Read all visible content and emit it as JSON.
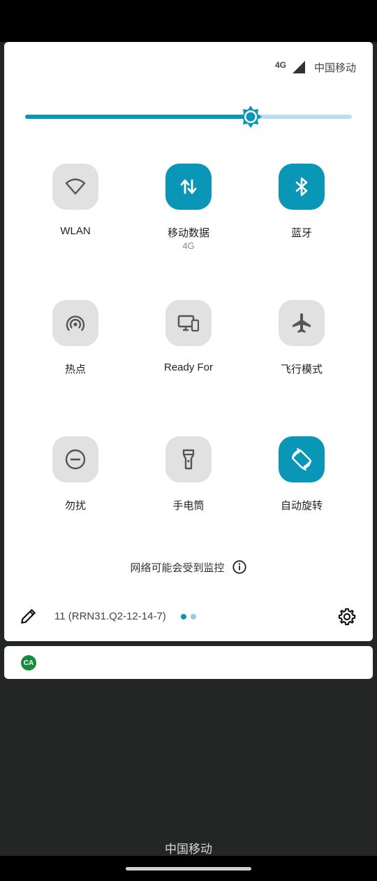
{
  "status": {
    "network_type": "4G",
    "carrier": "中国移动"
  },
  "brightness": {
    "level": 0.69,
    "accent": "#0a96b6",
    "track": "#b9dfe8"
  },
  "tiles": [
    {
      "label": "WLAN",
      "sub": "",
      "icon": "wifi-icon",
      "active": false
    },
    {
      "label": "移动数据",
      "sub": "4G",
      "icon": "mobile-data-icon",
      "active": true
    },
    {
      "label": "蓝牙",
      "sub": "",
      "icon": "bluetooth-icon",
      "active": true
    },
    {
      "label": "热点",
      "sub": "",
      "icon": "hotspot-icon",
      "active": false
    },
    {
      "label": "Ready For",
      "sub": "",
      "icon": "ready-for-icon",
      "active": false
    },
    {
      "label": "飞行模式",
      "sub": "",
      "icon": "airplane-icon",
      "active": false
    },
    {
      "label": "勿扰",
      "sub": "",
      "icon": "do-not-disturb-icon",
      "active": false
    },
    {
      "label": "手电筒",
      "sub": "",
      "icon": "flashlight-icon",
      "active": false
    },
    {
      "label": "自动旋转",
      "sub": "",
      "icon": "auto-rotate-icon",
      "active": true
    }
  ],
  "monitor_notice": "网络可能会受到监控",
  "footer": {
    "build": "11 (RRN31.Q2-12-14-7)",
    "page_count": 2,
    "current_page": 1
  },
  "notification": {
    "app_icon": "ca-app-icon",
    "app_icon_text": "CA",
    "app_color": "#1a8a3c"
  },
  "bottom_carrier": "中国移动"
}
